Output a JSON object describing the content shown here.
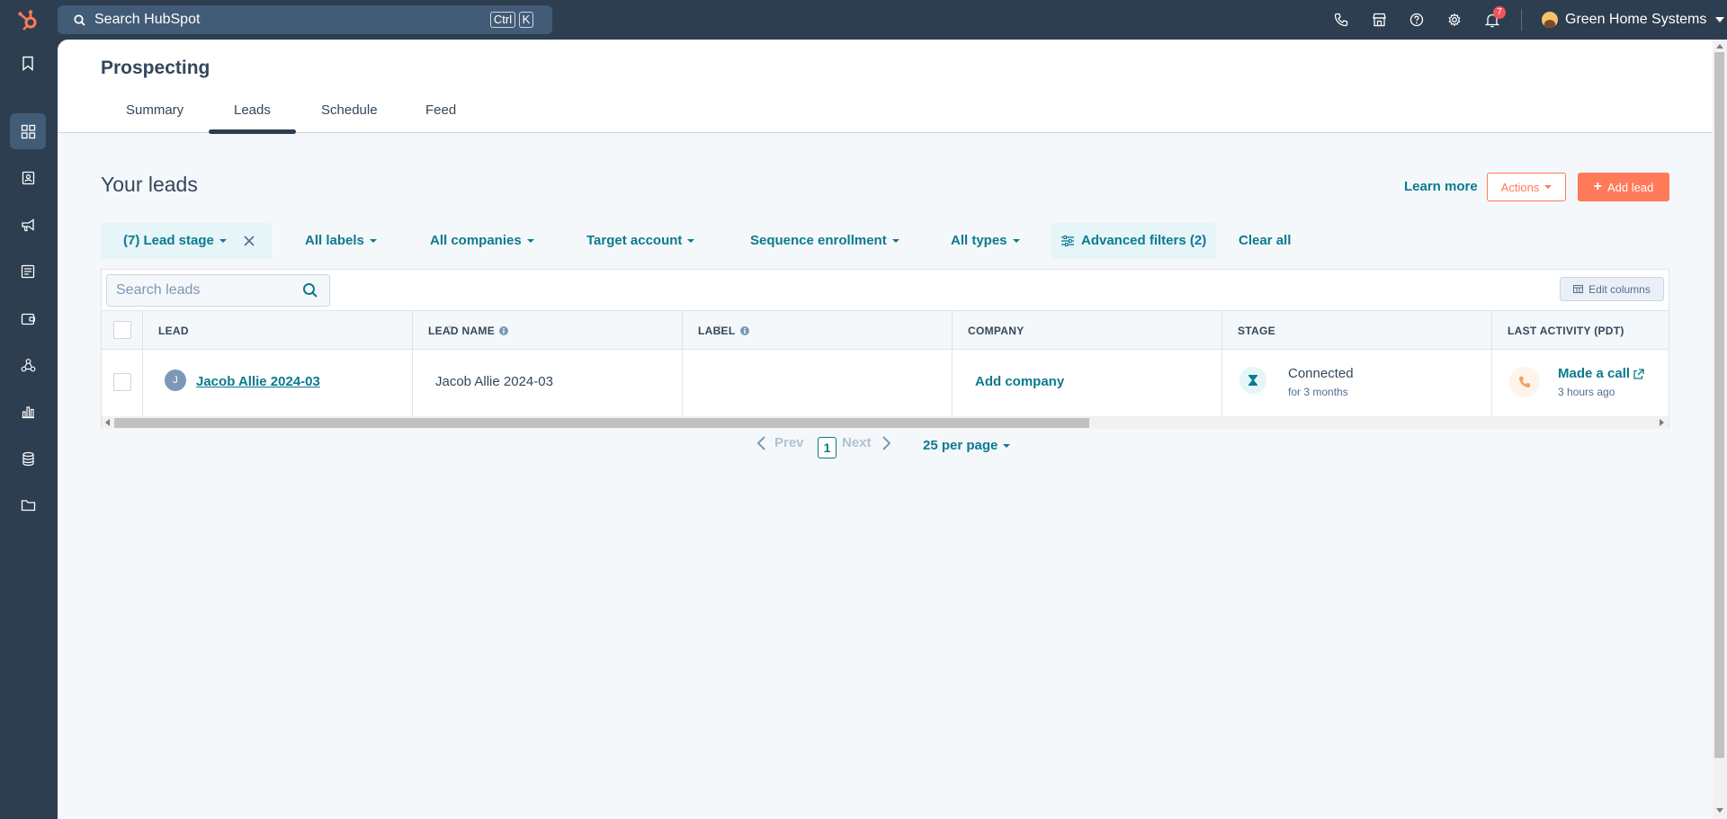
{
  "topbar": {
    "search_placeholder": "Search HubSpot",
    "shortcut_key1": "Ctrl",
    "shortcut_key2": "K",
    "notification_count": "7",
    "account_name": "Green Home Systems"
  },
  "sidenav": {
    "icons": [
      "bookmark-icon",
      "grid-icon",
      "contacts-icon",
      "megaphone-icon",
      "document-icon",
      "wallet-icon",
      "workflow-icon",
      "reports-icon",
      "database-icon",
      "folder-icon"
    ]
  },
  "header": {
    "title": "Prospecting",
    "tabs": [
      {
        "label": "Summary"
      },
      {
        "label": "Leads"
      },
      {
        "label": "Schedule"
      },
      {
        "label": "Feed"
      }
    ],
    "active_tab": "Leads"
  },
  "leads": {
    "heading": "Your leads",
    "learn_more": "Learn more",
    "actions_label": "Actions",
    "add_lead_label": "Add lead",
    "filters": {
      "lead_stage": "(7) Lead stage",
      "labels": "All labels",
      "companies": "All companies",
      "target_account": "Target account",
      "sequence": "Sequence enrollment",
      "types": "All types",
      "advanced": "Advanced filters (2)",
      "clear": "Clear all"
    }
  },
  "table": {
    "search_placeholder": "Search leads",
    "edit_columns": "Edit columns",
    "columns": [
      "LEAD",
      "LEAD NAME",
      "LABEL",
      "COMPANY",
      "STAGE",
      "LAST ACTIVITY (PDT)"
    ],
    "rows": [
      {
        "avatar_initial": "J",
        "lead": "Jacob Allie 2024-03",
        "lead_name": "Jacob Allie 2024-03",
        "label": "",
        "company": "Add company",
        "stage": "Connected",
        "stage_duration": "for 3 months",
        "activity": "Made a call",
        "activity_time": "3 hours ago"
      }
    ]
  },
  "pagination": {
    "prev": "Prev",
    "current_page": "1",
    "next": "Next",
    "per_page": "25 per page"
  },
  "colors": {
    "nav_bg": "#2d3e50",
    "accent_teal": "#0b7a8f",
    "orange": "#ff7a59",
    "page_bg": "#f5f8fa"
  }
}
